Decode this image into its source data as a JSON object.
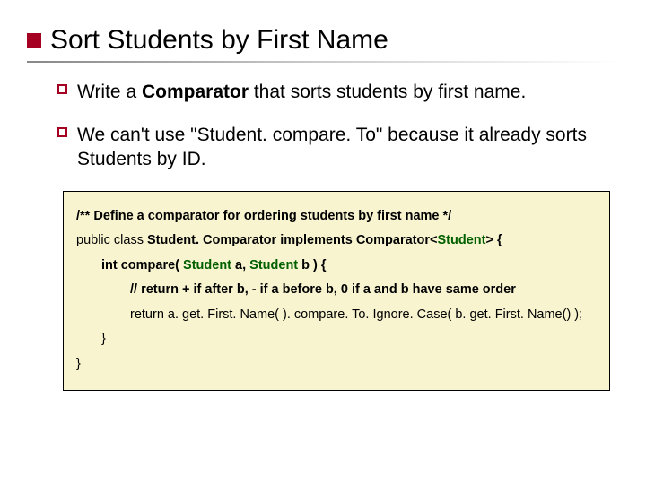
{
  "title": "Sort Students by First Name",
  "bullets": [
    {
      "pre": "Write a ",
      "bold": "Comparator",
      "post": " that sorts students by first name."
    },
    {
      "pre": "We can't use \"Student. compare. To\" because it already sorts Students by ID.",
      "bold": "",
      "post": ""
    }
  ],
  "code": {
    "l1": "/** Define a comparator for ordering students by first name */",
    "l2a": "public class ",
    "l2b": "Student. Comparator",
    "l2c": " implements ",
    "l2d": "Comparator<",
    "l2e": "Student",
    "l2f": "> {",
    "l3a": "int compare( ",
    "l3b": "Student",
    "l3c": " a, ",
    "l3d": "Student",
    "l3e": " b ) {",
    "l4": "// return + if  after b, - if a before b, 0 if a and b have same order",
    "l5": "return  a. get. First. Name( ). compare. To. Ignore. Case( b. get. First. Name() );",
    "l6": "}",
    "l7": "}"
  }
}
